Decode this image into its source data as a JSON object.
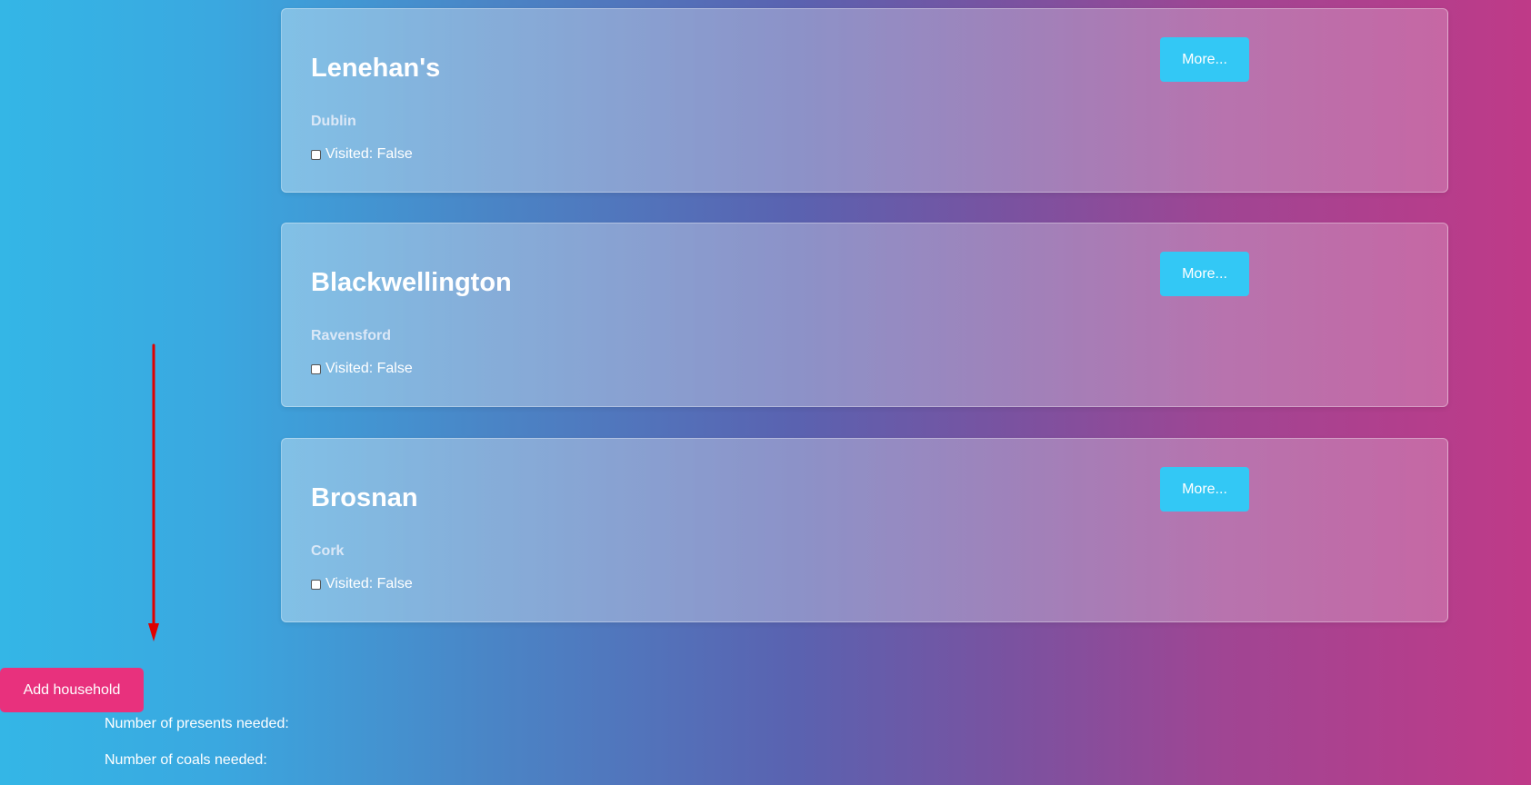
{
  "households": [
    {
      "name": "Lenehan's",
      "city": "Dublin",
      "visited_label": "Visited: False",
      "visited": false,
      "more_label": "More..."
    },
    {
      "name": "Blackwellington",
      "city": "Ravensford",
      "visited_label": "Visited: False",
      "visited": false,
      "more_label": "More..."
    },
    {
      "name": "Brosnan",
      "city": "Cork",
      "visited_label": "Visited: False",
      "visited": false,
      "more_label": "More..."
    }
  ],
  "actions": {
    "add_household_label": "Add household"
  },
  "stats": {
    "presents_label": "Number of presents needed:",
    "coals_label": "Number of coals needed:"
  },
  "colors": {
    "more_button": "#33c8f5",
    "add_button": "#e8317d",
    "arrow": "#e00000"
  }
}
